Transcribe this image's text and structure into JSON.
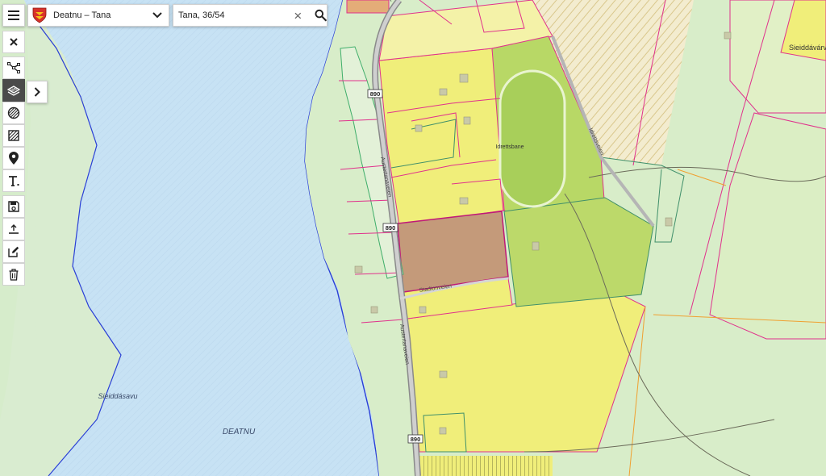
{
  "header": {
    "menu_icon": "hamburger-menu-icon",
    "municipality": {
      "name": "Deatnu – Tana",
      "icon": "municipality-shield-icon",
      "dropdown_icon": "chevron-down-icon"
    },
    "search": {
      "value": "Tana, 36/54",
      "clear_icon": "close-icon",
      "search_icon": "search-icon"
    }
  },
  "toolbar": {
    "tools": [
      {
        "name": "close",
        "icon": "close-icon"
      },
      {
        "name": "measure",
        "icon": "measure-line-icon"
      },
      {
        "name": "layers",
        "icon": "area-layer-icon",
        "active": true
      },
      {
        "name": "hatch-circle",
        "icon": "hatch-circle-icon"
      },
      {
        "name": "hatch-square",
        "icon": "hatch-square-icon"
      },
      {
        "name": "marker",
        "icon": "map-pin-icon"
      },
      {
        "name": "text",
        "icon": "text-tool-icon"
      },
      {
        "name": "save",
        "icon": "save-icon"
      },
      {
        "name": "upload",
        "icon": "upload-icon"
      },
      {
        "name": "edit",
        "icon": "edit-icon"
      },
      {
        "name": "delete",
        "icon": "trash-icon"
      }
    ],
    "expand_icon": "chevron-right-icon"
  },
  "map": {
    "labels": {
      "river": "DEATNU",
      "riverbank": "Sieiddásavu",
      "top_right": "Sieiddávárv",
      "stadium": "Idrettsbane",
      "road_main": "Austertanaveien",
      "road_stadium": "Stadionveien",
      "road_idrett": "Idrettsveien"
    },
    "road_number": "890",
    "colors": {
      "water": "#c7e2f4",
      "land": "#d9ecd0",
      "yellow_zone": "#f0ee7a",
      "green_zone": "#b8d866",
      "selected_parcel": "#c49a7a",
      "parcel_border": "#e0318c",
      "shoreline": "#2a3fd6"
    }
  }
}
